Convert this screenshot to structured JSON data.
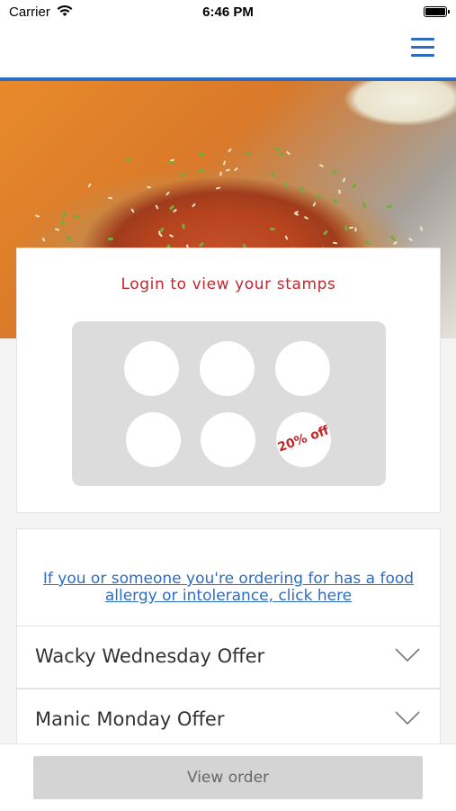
{
  "status_bar": {
    "carrier": "Carrier",
    "time": "6:46 PM",
    "icons": [
      "wifi-icon",
      "battery-icon"
    ]
  },
  "nav": {
    "menu_icon": "hamburger-menu-icon",
    "accent_color": "#2d6cc0"
  },
  "stamp_card": {
    "title": "Login to view your stamps",
    "stamps_total": 6,
    "stamps_collected": 0,
    "reward_text": "20% off",
    "title_color": "#c1272d"
  },
  "allergy": {
    "link_text": "If you or someone you're ordering for has a food allergy or intolerance, click here"
  },
  "offers": [
    {
      "label": "Wacky Wednesday Offer",
      "icon": "chevron-down-icon"
    },
    {
      "label": "Manic Monday Offer",
      "icon": "chevron-down-icon"
    }
  ],
  "bottom_bar": {
    "button_label": "View order"
  }
}
